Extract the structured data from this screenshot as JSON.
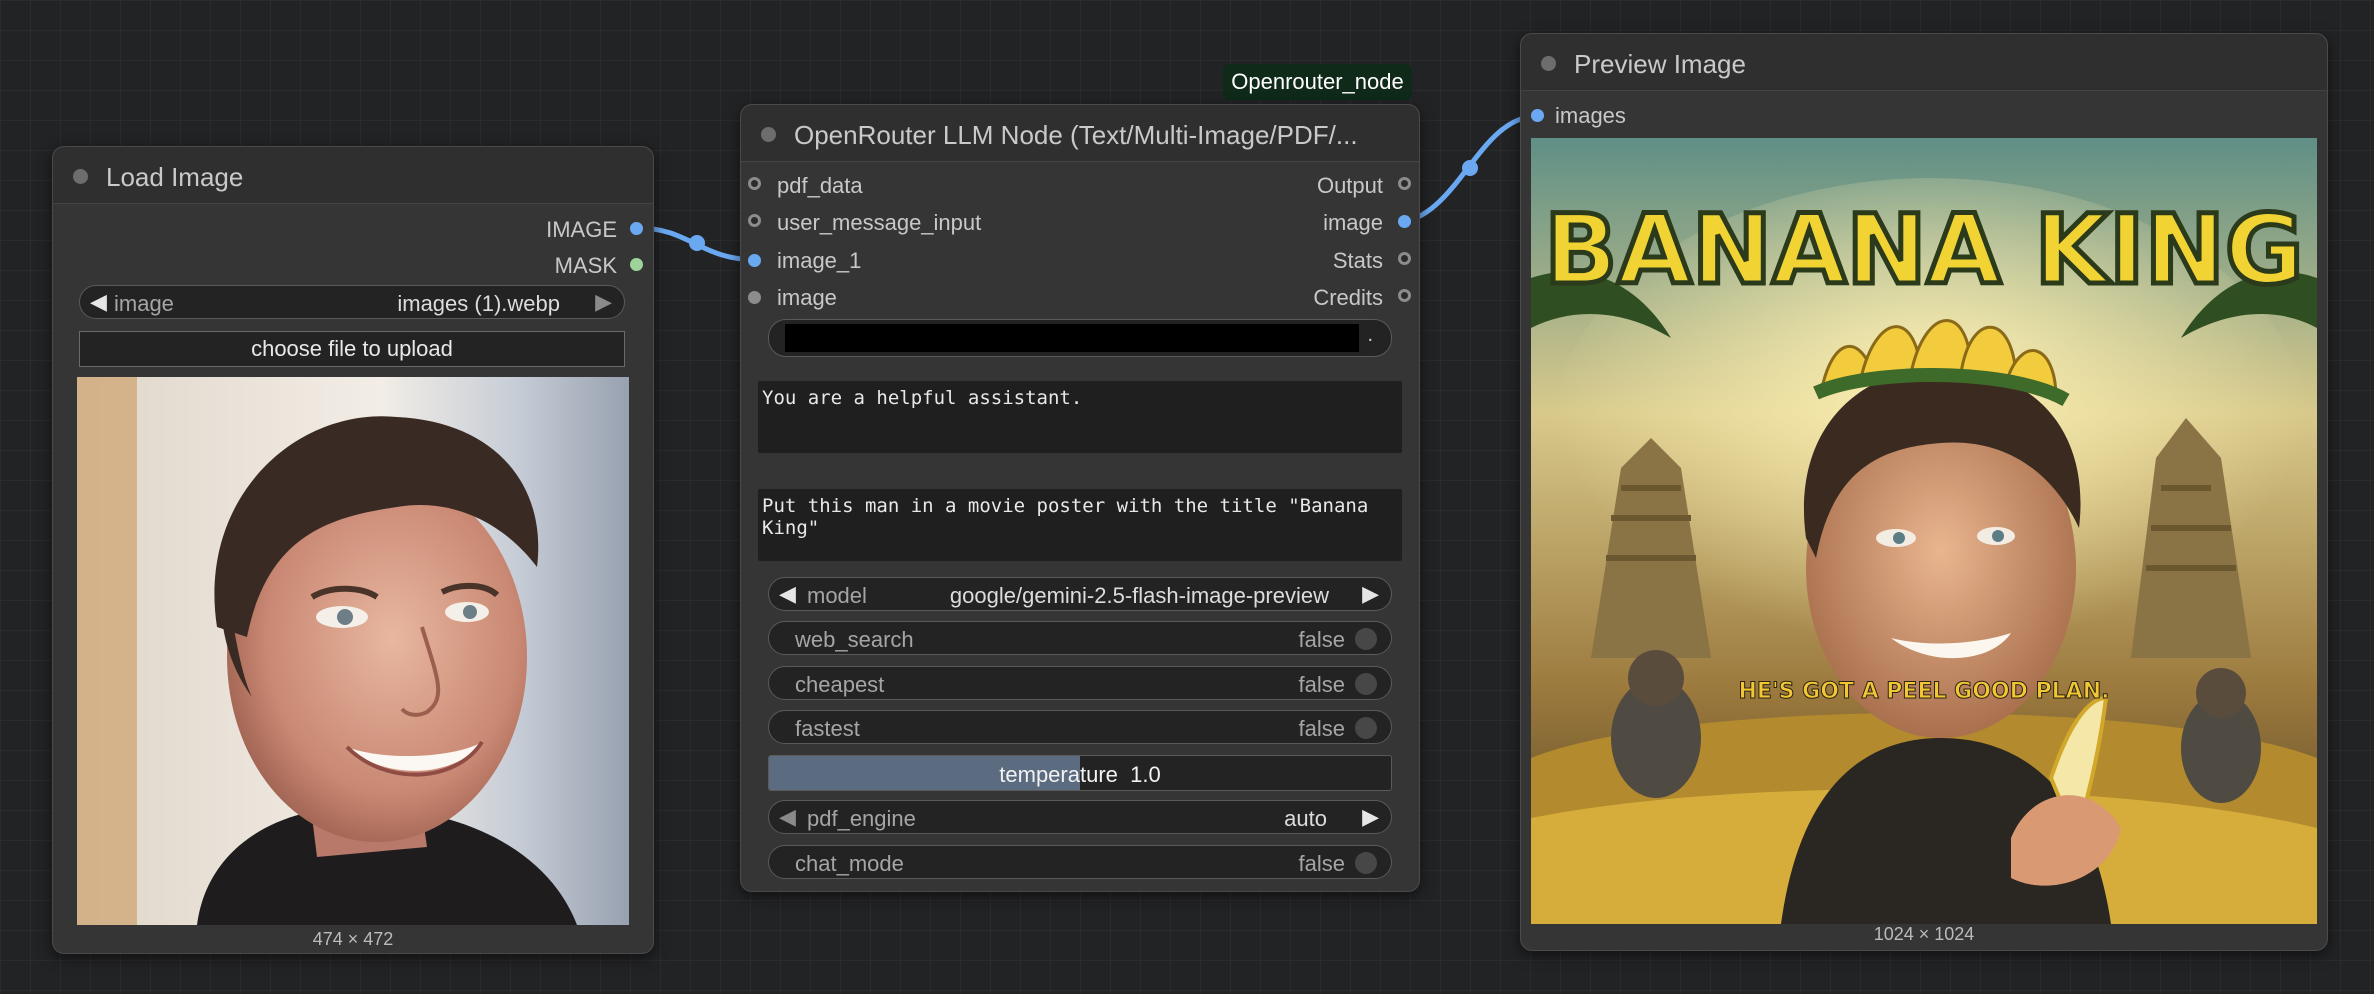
{
  "floating_label": "Openrouter_node",
  "load_image": {
    "title": "Load Image",
    "outputs": [
      {
        "label": "IMAGE"
      },
      {
        "label": "MASK"
      }
    ],
    "image_widget": {
      "label": "image",
      "value": "images (1).webp"
    },
    "upload_button": "choose file to upload",
    "image_size": "474 × 472"
  },
  "llm_node": {
    "title": "OpenRouter LLM Node (Text/Multi-Image/PDF/...",
    "inputs": [
      "pdf_data",
      "user_message_input",
      "image_1",
      "image"
    ],
    "outputs": [
      "Output",
      "image",
      "Stats",
      "Credits"
    ],
    "api_key_suffix": ".",
    "system_prompt": "You are a helpful assistant.",
    "user_prompt": "Put this man in a movie poster with the title \"Banana\nKing\"",
    "widgets": {
      "model": {
        "label": "model",
        "value": "google/gemini-2.5-flash-image-preview"
      },
      "web_search": {
        "label": "web_search",
        "value": "false"
      },
      "cheapest": {
        "label": "cheapest",
        "value": "false"
      },
      "fastest": {
        "label": "fastest",
        "value": "false"
      },
      "temperature": {
        "label": "temperature",
        "value": "1.0",
        "fill_fraction": 0.5
      },
      "pdf_engine": {
        "label": "pdf_engine",
        "value": "auto"
      },
      "chat_mode": {
        "label": "chat_mode",
        "value": "false"
      }
    }
  },
  "preview": {
    "title": "Preview Image",
    "input": "images",
    "poster_title": "BANANA KING",
    "poster_tagline": "HE'S GOT A PEEL GOOD PLAN.",
    "image_size": "1024 × 1024"
  },
  "colors": {
    "link": "#6aa9f2",
    "image_slot": "#6aa9f2",
    "mask_slot": "#9ed39a"
  }
}
